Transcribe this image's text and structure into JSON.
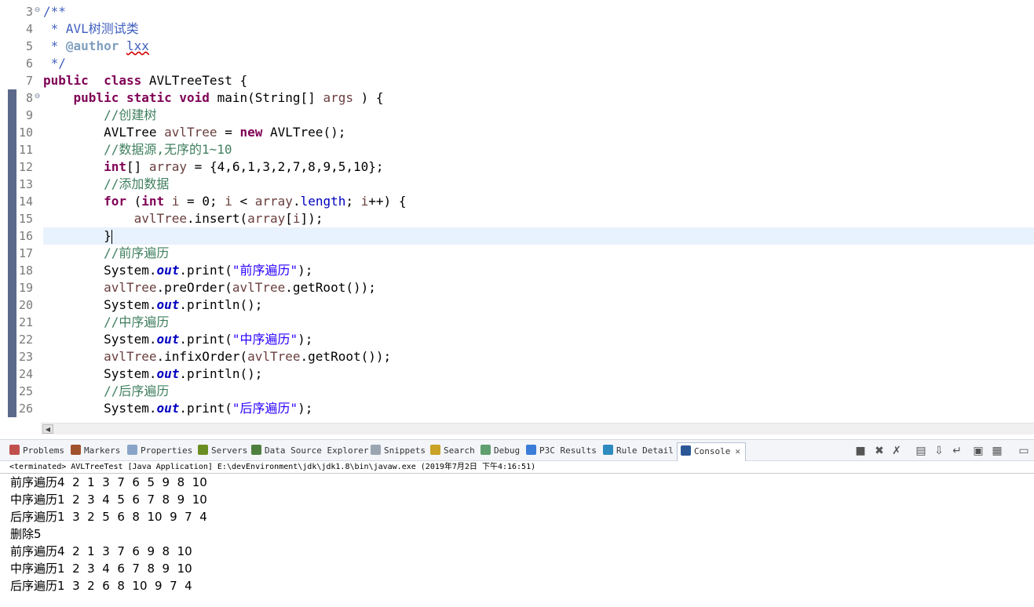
{
  "editor": {
    "lines": [
      {
        "n": "3",
        "fold": "⊖",
        "mark": false,
        "current": false,
        "segs": [
          [
            "jd",
            "/**"
          ]
        ]
      },
      {
        "n": "4",
        "fold": "",
        "mark": false,
        "current": false,
        "segs": [
          [
            "jd",
            " * AVL树测试类"
          ]
        ]
      },
      {
        "n": "5",
        "fold": "",
        "mark": false,
        "current": false,
        "segs": [
          [
            "jd",
            " * "
          ],
          [
            "tag",
            "@author"
          ],
          [
            "jd",
            " "
          ],
          [
            "jdsq",
            "lxx"
          ]
        ]
      },
      {
        "n": "6",
        "fold": "",
        "mark": false,
        "current": false,
        "segs": [
          [
            "jd",
            " */"
          ]
        ]
      },
      {
        "n": "7",
        "fold": "",
        "mark": false,
        "current": false,
        "segs": [
          [
            "kw",
            "public"
          ],
          [
            "",
            "  "
          ],
          [
            "kw",
            "class"
          ],
          [
            "",
            " AVLTreeTest {"
          ]
        ]
      },
      {
        "n": "8",
        "fold": "⊖",
        "mark": true,
        "current": false,
        "segs": [
          [
            "",
            "    "
          ],
          [
            "kw",
            "public"
          ],
          [
            "",
            " "
          ],
          [
            "kw",
            "static"
          ],
          [
            "",
            " "
          ],
          [
            "kw",
            "void"
          ],
          [
            "",
            " main(String[] "
          ],
          [
            "lv",
            "args"
          ],
          [
            "",
            " ) {"
          ]
        ]
      },
      {
        "n": "9",
        "fold": "",
        "mark": true,
        "current": false,
        "segs": [
          [
            "",
            "        "
          ],
          [
            "cm",
            "//创建树"
          ]
        ]
      },
      {
        "n": "10",
        "fold": "",
        "mark": true,
        "current": false,
        "segs": [
          [
            "",
            "        AVLTree "
          ],
          [
            "lv",
            "avlTree"
          ],
          [
            "",
            " = "
          ],
          [
            "kw",
            "new"
          ],
          [
            "",
            " AVLTree();"
          ]
        ]
      },
      {
        "n": "11",
        "fold": "",
        "mark": true,
        "current": false,
        "segs": [
          [
            "",
            "        "
          ],
          [
            "cm",
            "//数据源,无序的1~10"
          ]
        ]
      },
      {
        "n": "12",
        "fold": "",
        "mark": true,
        "current": false,
        "segs": [
          [
            "",
            "        "
          ],
          [
            "kw",
            "int"
          ],
          [
            "",
            "[] "
          ],
          [
            "lv",
            "array"
          ],
          [
            "",
            " = {4,6,1,3,2,7,8,9,5,10};"
          ]
        ]
      },
      {
        "n": "13",
        "fold": "",
        "mark": true,
        "current": false,
        "segs": [
          [
            "",
            "        "
          ],
          [
            "cm",
            "//添加数据"
          ]
        ]
      },
      {
        "n": "14",
        "fold": "",
        "mark": true,
        "current": false,
        "segs": [
          [
            "",
            "        "
          ],
          [
            "kw",
            "for"
          ],
          [
            "",
            " ("
          ],
          [
            "kw",
            "int"
          ],
          [
            "",
            " "
          ],
          [
            "lv",
            "i"
          ],
          [
            "",
            " = 0; "
          ],
          [
            "lv",
            "i"
          ],
          [
            "",
            " < "
          ],
          [
            "lv",
            "array"
          ],
          [
            "",
            "."
          ],
          [
            "fl2",
            "length"
          ],
          [
            "",
            "; "
          ],
          [
            "lv",
            "i"
          ],
          [
            "",
            "++) {"
          ]
        ]
      },
      {
        "n": "15",
        "fold": "",
        "mark": true,
        "current": false,
        "segs": [
          [
            "",
            "            "
          ],
          [
            "lv",
            "avlTree"
          ],
          [
            "",
            ".insert("
          ],
          [
            "lv",
            "array"
          ],
          [
            "",
            "["
          ],
          [
            "lv",
            "i"
          ],
          [
            "",
            "]);"
          ]
        ]
      },
      {
        "n": "16",
        "fold": "",
        "mark": true,
        "current": true,
        "segs": [
          [
            "",
            "        }"
          ],
          [
            "caret",
            ""
          ]
        ]
      },
      {
        "n": "17",
        "fold": "",
        "mark": true,
        "current": false,
        "segs": [
          [
            "",
            "        "
          ],
          [
            "cm",
            "//前序遍历"
          ]
        ]
      },
      {
        "n": "18",
        "fold": "",
        "mark": true,
        "current": false,
        "segs": [
          [
            "",
            "        System."
          ],
          [
            "fld",
            "out"
          ],
          [
            "",
            ".print("
          ],
          [
            "st",
            "\"前序遍历\""
          ],
          [
            "",
            ");"
          ]
        ]
      },
      {
        "n": "19",
        "fold": "",
        "mark": true,
        "current": false,
        "segs": [
          [
            "",
            "        "
          ],
          [
            "lv",
            "avlTree"
          ],
          [
            "",
            ".preOrder("
          ],
          [
            "lv",
            "avlTree"
          ],
          [
            "",
            ".getRoot());"
          ]
        ]
      },
      {
        "n": "20",
        "fold": "",
        "mark": true,
        "current": false,
        "segs": [
          [
            "",
            "        System."
          ],
          [
            "fld",
            "out"
          ],
          [
            "",
            ".println();"
          ]
        ]
      },
      {
        "n": "21",
        "fold": "",
        "mark": true,
        "current": false,
        "segs": [
          [
            "",
            "        "
          ],
          [
            "cm",
            "//中序遍历"
          ]
        ]
      },
      {
        "n": "22",
        "fold": "",
        "mark": true,
        "current": false,
        "segs": [
          [
            "",
            "        System."
          ],
          [
            "fld",
            "out"
          ],
          [
            "",
            ".print("
          ],
          [
            "st",
            "\"中序遍历\""
          ],
          [
            "",
            ");"
          ]
        ]
      },
      {
        "n": "23",
        "fold": "",
        "mark": true,
        "current": false,
        "segs": [
          [
            "",
            "        "
          ],
          [
            "lv",
            "avlTree"
          ],
          [
            "",
            ".infixOrder("
          ],
          [
            "lv",
            "avlTree"
          ],
          [
            "",
            ".getRoot());"
          ]
        ]
      },
      {
        "n": "24",
        "fold": "",
        "mark": true,
        "current": false,
        "segs": [
          [
            "",
            "        System."
          ],
          [
            "fld",
            "out"
          ],
          [
            "",
            ".println();"
          ]
        ]
      },
      {
        "n": "25",
        "fold": "",
        "mark": true,
        "current": false,
        "segs": [
          [
            "",
            "        "
          ],
          [
            "cm",
            "//后序遍历"
          ]
        ]
      },
      {
        "n": "26",
        "fold": "",
        "mark": true,
        "current": false,
        "segs": [
          [
            "",
            "        System."
          ],
          [
            "fld",
            "out"
          ],
          [
            "",
            ".print("
          ],
          [
            "st",
            "\"后序遍历\""
          ],
          [
            "",
            ");"
          ]
        ]
      }
    ]
  },
  "views": {
    "tabs": [
      {
        "label": "Problems",
        "icon": "problems-icon",
        "color": "#c0504d",
        "active": false
      },
      {
        "label": "Markers",
        "icon": "markers-icon",
        "color": "#a0522d",
        "active": false
      },
      {
        "label": "Properties",
        "icon": "properties-icon",
        "color": "#8aa4c8",
        "active": false
      },
      {
        "label": "Servers",
        "icon": "servers-icon",
        "color": "#6b8e23",
        "active": false
      },
      {
        "label": "Data Source Explorer",
        "icon": "data-source-icon",
        "color": "#4f7f3f",
        "active": false
      },
      {
        "label": "Snippets",
        "icon": "snippets-icon",
        "color": "#9aa5b1",
        "active": false
      },
      {
        "label": "Search",
        "icon": "search-icon",
        "color": "#c9a227",
        "active": false
      },
      {
        "label": "Debug",
        "icon": "debug-icon",
        "color": "#5f9e6e",
        "active": false
      },
      {
        "label": "P3C Results",
        "icon": "p3c-icon",
        "color": "#3b7dd8",
        "active": false
      },
      {
        "label": "Rule Detail",
        "icon": "rule-detail-icon",
        "color": "#2e8bc0",
        "active": false
      },
      {
        "label": "Console",
        "icon": "console-icon",
        "color": "#2b5797",
        "active": true
      }
    ],
    "close_symbol": "✕"
  },
  "console": {
    "header": "<terminated> AVLTreeTest [Java Application] E:\\devEnvironment\\jdk\\jdk1.8\\bin\\javaw.exe (2019年7月2日 下午4:16:51)",
    "output": [
      "前序遍历4  2  1  3  7  6  5  9  8  10",
      "中序遍历1  2  3  4  5  6  7  8  9  10",
      "后序遍历1  3  2  5  6  8  10  9  7  4",
      "删除5",
      "前序遍历4  2  1  3  7  6  9  8  10",
      "中序遍历1  2  3  4  6  7  8  9  10",
      "后序遍历1  3  2  6  8  10  9  7  4"
    ]
  }
}
